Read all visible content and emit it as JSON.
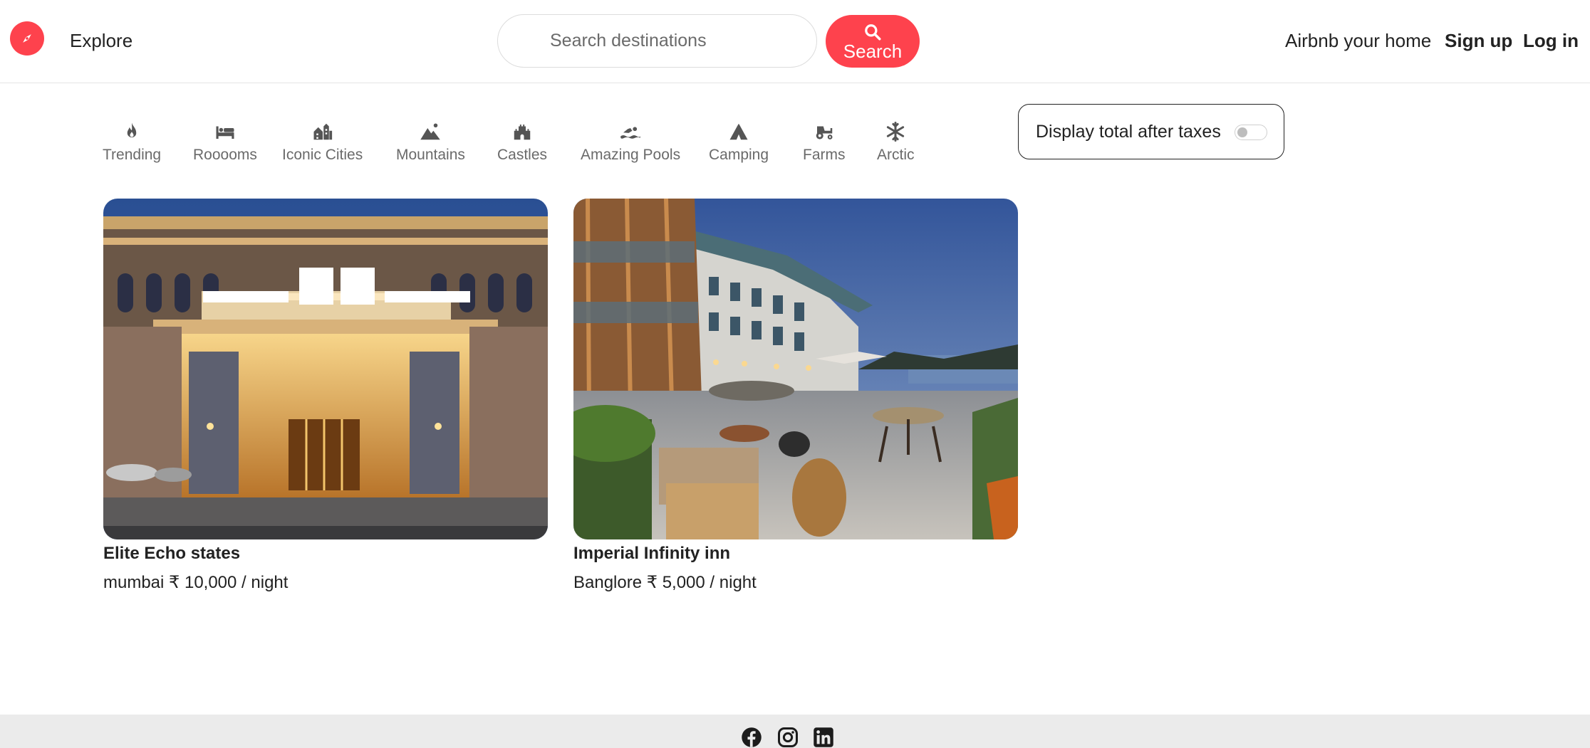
{
  "navbar": {
    "explore_label": "Explore",
    "search_placeholder": "Search destinations",
    "search_button_label": "Search",
    "host_link": "Airbnb your home",
    "signup_link": "Sign up",
    "login_link": "Log in"
  },
  "filters": [
    {
      "label": "Trending",
      "icon": "fire-icon"
    },
    {
      "label": "Rooooms",
      "icon": "bed-icon"
    },
    {
      "label": "Iconic Cities",
      "icon": "city-icon"
    },
    {
      "label": "Mountains",
      "icon": "mountain-icon"
    },
    {
      "label": "Castles",
      "icon": "castle-icon"
    },
    {
      "label": "Amazing Pools",
      "icon": "swimmer-icon"
    },
    {
      "label": "Camping",
      "icon": "tent-icon"
    },
    {
      "label": "Farms",
      "icon": "tractor-icon"
    },
    {
      "label": "Arctic",
      "icon": "snowflake-icon"
    }
  ],
  "tax_toggle": {
    "label": "Display total after taxes",
    "enabled": false
  },
  "listings": [
    {
      "title": "Elite Echo states",
      "location": "mumbai",
      "price": "₹ 10,000",
      "unit": "/ night"
    },
    {
      "title": "Imperial Infinity inn",
      "location": "Banglore",
      "price": "₹ 5,000",
      "unit": "/ night"
    }
  ],
  "footer": {
    "social_icons": [
      "facebook-icon",
      "instagram-icon",
      "linkedin-icon"
    ]
  },
  "colors": {
    "brand": "#fe424d",
    "footer_bg": "#ebebeb"
  }
}
